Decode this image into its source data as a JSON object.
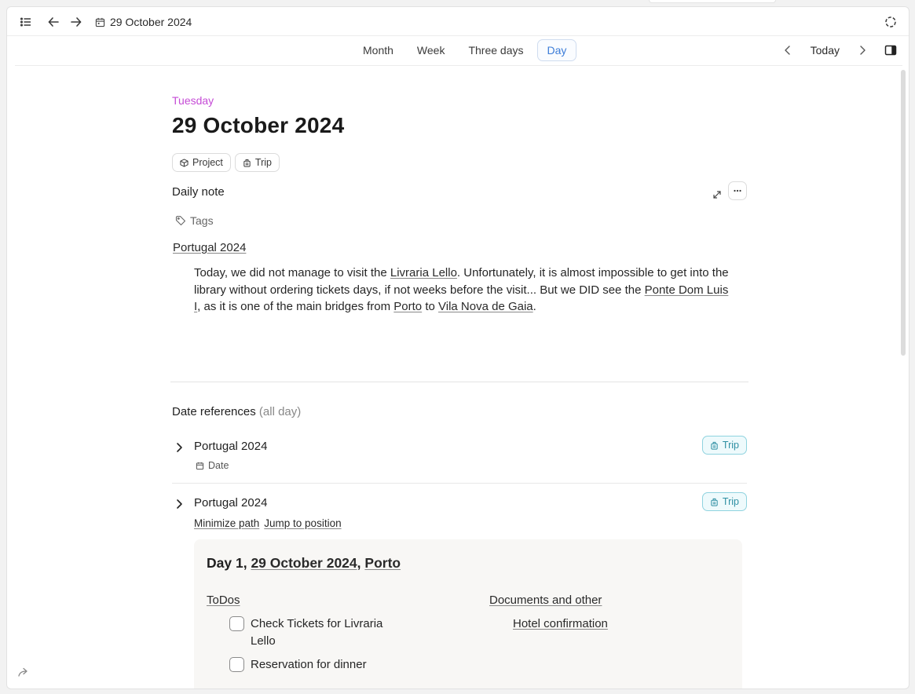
{
  "topbar": {
    "title": "29 October 2024",
    "icons": [
      "list-icon",
      "back-arrow-icon",
      "forward-arrow-icon",
      "calendar-icon",
      "sync-icon"
    ]
  },
  "viewbar": {
    "tabs": [
      {
        "label": "Month",
        "active": false
      },
      {
        "label": "Week",
        "active": false
      },
      {
        "label": "Three days",
        "active": false
      },
      {
        "label": "Day",
        "active": true
      }
    ],
    "today_label": "Today"
  },
  "note": {
    "weekday": "Tuesday",
    "date_title": "29 October 2024",
    "chips": [
      {
        "label": "Project",
        "icon": "cube-icon"
      },
      {
        "label": "Trip",
        "icon": "luggage-icon"
      }
    ],
    "type_label": "Daily note",
    "tags_label": "Tags",
    "page_link": "Portugal 2024",
    "body": {
      "t1": "Today, we did not manage to visit the ",
      "l1": "Livraria Lello",
      "t2": ". Unfortunately, it is almost impossible to get into the library without ordering tickets days, if not weeks before the visit... But we DID see the ",
      "l2": "Ponte Dom Luis I",
      "t3": ", as it is one of the main bridges from ",
      "l3": "Porto",
      "t4": " to ",
      "l4": "Vila Nova de Gaia",
      "t5": "."
    }
  },
  "references": {
    "title": "Date references",
    "title_suffix": "(all day)",
    "items": [
      {
        "name": "Portugal 2024",
        "badge": "Trip",
        "sub_label": "Date"
      },
      {
        "name": "Portugal 2024",
        "badge": "Trip",
        "links": [
          "Minimize path",
          "Jump to position"
        ]
      }
    ],
    "card": {
      "title_prefix": "Day 1, ",
      "title_date": "29 October 2024",
      "title_sep": ", ",
      "title_place": "Porto",
      "todos_label": "ToDos",
      "todos": [
        "Check Tickets for Livraria Lello",
        "Reservation for dinner"
      ],
      "docs_label": "Documents and other",
      "docs": [
        "Hotel confirmation"
      ]
    }
  },
  "colors": {
    "weekday": "#c54bd6",
    "active_tab": "#3d7dd8",
    "trip_badge": "#2e8fa3"
  }
}
